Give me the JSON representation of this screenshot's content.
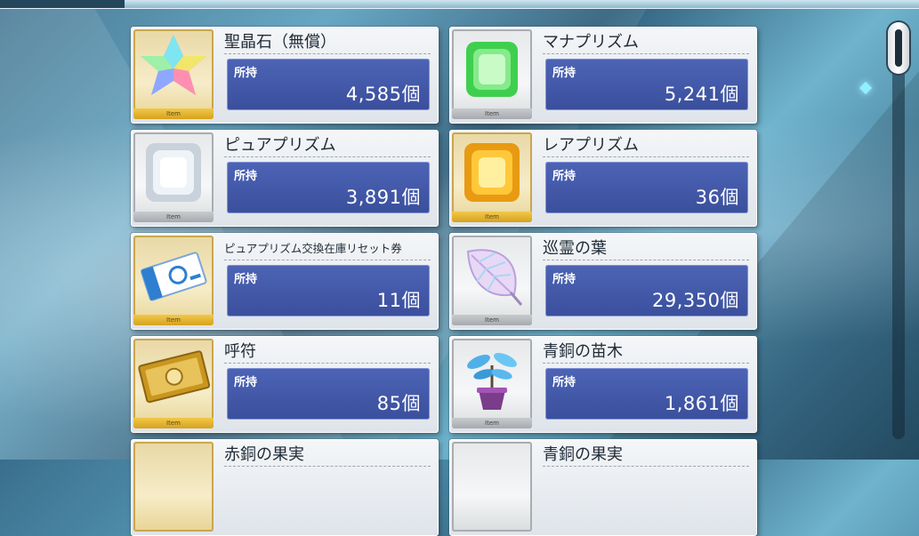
{
  "hold_label": "所持",
  "thumb_band": "Item",
  "items": [
    {
      "name": "聖晶石（無償）",
      "count": "4,585個",
      "frame": "gold",
      "icon": "saint-quartz-icon"
    },
    {
      "name": "マナプリズム",
      "count": "5,241個",
      "frame": "silver",
      "icon": "mana-prism-icon"
    },
    {
      "name": "ピュアプリズム",
      "count": "3,891個",
      "frame": "silver",
      "icon": "pure-prism-icon"
    },
    {
      "name": "レアプリズム",
      "count": "36個",
      "frame": "gold",
      "icon": "rare-prism-icon"
    },
    {
      "name": "ピュアプリズム交換在庫リセット券",
      "count": "11個",
      "frame": "gold",
      "icon": "reset-ticket-icon"
    },
    {
      "name": "巡霊の葉",
      "count": "29,350個",
      "frame": "silver",
      "icon": "leaf-icon"
    },
    {
      "name": "呼符",
      "count": "85個",
      "frame": "gold",
      "icon": "summon-ticket-icon"
    },
    {
      "name": "青銅の苗木",
      "count": "1,861個",
      "frame": "silver",
      "icon": "bronze-sapling-icon"
    },
    {
      "name": "赤銅の果実",
      "count": "",
      "frame": "gold",
      "icon": "copper-fruit-icon"
    },
    {
      "name": "青銅の果実",
      "count": "",
      "frame": "silver",
      "icon": "bronze-fruit-icon"
    }
  ]
}
